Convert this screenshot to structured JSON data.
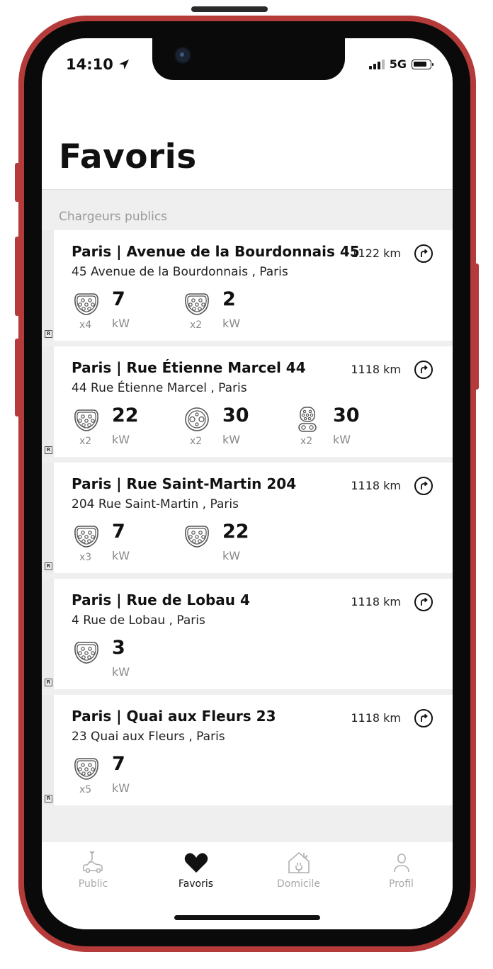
{
  "status_bar": {
    "time": "14:10",
    "network": "5G"
  },
  "header": {
    "title": "Favoris"
  },
  "section": {
    "label": "Chargeurs publics"
  },
  "chargers": [
    {
      "title": "Paris | Avenue de la Bourdonnais 45",
      "address": "45 Avenue de la Bourdonnais , Paris",
      "distance": "1122 km",
      "connectors": [
        {
          "type": "type2-icon",
          "power": "7",
          "unit": "kW",
          "count": "x4"
        },
        {
          "type": "type2-icon",
          "power": "2",
          "unit": "kW",
          "count": "x2"
        }
      ]
    },
    {
      "title": "Paris | Rue Étienne Marcel 44",
      "address": "44 Rue Étienne Marcel , Paris",
      "distance": "1118 km",
      "connectors": [
        {
          "type": "type2-icon",
          "power": "22",
          "unit": "kW",
          "count": "x2"
        },
        {
          "type": "chademo-icon",
          "power": "30",
          "unit": "kW",
          "count": "x2"
        },
        {
          "type": "ccs-icon",
          "power": "30",
          "unit": "kW",
          "count": "x2"
        }
      ]
    },
    {
      "title": "Paris | Rue Saint-Martin 204",
      "address": "204 Rue Saint-Martin , Paris",
      "distance": "1118 km",
      "connectors": [
        {
          "type": "type2-icon",
          "power": "7",
          "unit": "kW",
          "count": "x3"
        },
        {
          "type": "type2-icon",
          "power": "22",
          "unit": "kW",
          "count": ""
        }
      ]
    },
    {
      "title": "Paris | Rue de Lobau 4",
      "address": "4 Rue de Lobau , Paris",
      "distance": "1118 km",
      "connectors": [
        {
          "type": "type2-icon",
          "power": "3",
          "unit": "kW",
          "count": ""
        }
      ]
    },
    {
      "title": "Paris | Quai aux Fleurs 23",
      "address": "23 Quai aux Fleurs , Paris",
      "distance": "1118 km",
      "connectors": [
        {
          "type": "type2-icon",
          "power": "7",
          "unit": "kW",
          "count": "x5"
        }
      ]
    }
  ],
  "tabs": [
    {
      "label": "Public",
      "icon": "car-charging-icon",
      "active": false
    },
    {
      "label": "Favoris",
      "icon": "heart-icon",
      "active": true
    },
    {
      "label": "Domicile",
      "icon": "home-plug-icon",
      "active": false
    },
    {
      "label": "Profil",
      "icon": "person-icon",
      "active": false
    }
  ],
  "colors": {
    "frame": "#b53a3a",
    "text": "#111111",
    "muted": "#9a9a9a",
    "background": "#efefef"
  }
}
